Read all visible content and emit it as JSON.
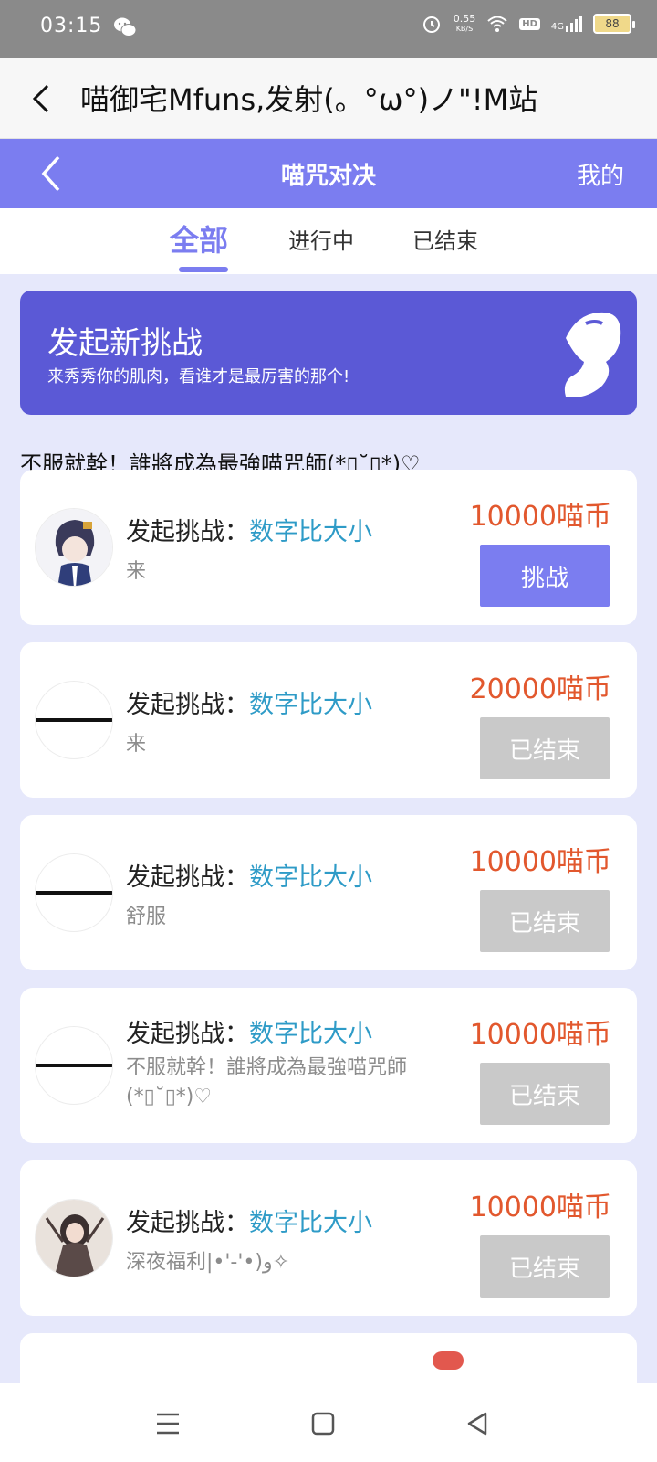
{
  "status_bar": {
    "time": "03:15",
    "net_speed_value": "0.55",
    "net_speed_unit": "KB/S",
    "hd": "HD",
    "signal": "4G",
    "battery": "88"
  },
  "browser": {
    "title": "喵御宅Mfuns,发射(。°ω°)ノ\"!M站"
  },
  "header": {
    "title": "喵咒对决",
    "mine": "我的"
  },
  "tabs": [
    {
      "label": "全部",
      "active": true
    },
    {
      "label": "进行中",
      "active": false
    },
    {
      "label": "已结束",
      "active": false
    }
  ],
  "banner": {
    "heading": "发起新挑战",
    "subtitle": "来秀秀你的肌肉，看谁才是最厉害的那个!"
  },
  "notice": "不服就幹！誰將成為最強喵咒師(*▯˘▯*)♡",
  "challenges": [
    {
      "prefix": "发起挑战：",
      "game": "数字比大小",
      "message": "来",
      "amount": "10000喵币",
      "button": "挑战",
      "state": "active",
      "avatar": "anime-boy"
    },
    {
      "prefix": "发起挑战：",
      "game": "数字比大小",
      "message": "来",
      "amount": "20000喵币",
      "button": "已结束",
      "state": "done",
      "avatar": "blank"
    },
    {
      "prefix": "发起挑战：",
      "game": "数字比大小",
      "message": "舒服",
      "amount": "10000喵币",
      "button": "已结束",
      "state": "done",
      "avatar": "blank"
    },
    {
      "prefix": "发起挑战：",
      "game": "数字比大小",
      "message": "不服就幹！誰將成為最強喵咒師(*▯˘▯*)♡",
      "amount": "10000喵币",
      "button": "已结束",
      "state": "done",
      "avatar": "blank"
    },
    {
      "prefix": "发起挑战：",
      "game": "数字比大小",
      "message": "深夜福利|•'-'•)و✧",
      "amount": "10000喵币",
      "button": "已结束",
      "state": "done",
      "avatar": "anime-girl"
    }
  ],
  "colors": {
    "accent": "#7b7df0",
    "banner": "#5b59d6",
    "amount": "#e2582e",
    "game_link": "#2e9bc7",
    "page_bg": "#e6e8fb"
  },
  "nav_icons": [
    "menu-icon",
    "home-icon",
    "back-icon"
  ]
}
